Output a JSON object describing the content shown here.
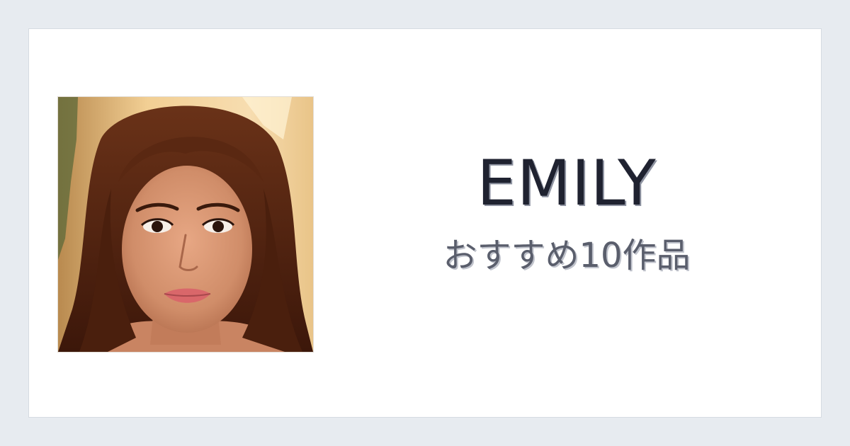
{
  "card": {
    "title": "EMILY",
    "subtitle": "おすすめ10作品"
  },
  "colors": {
    "page_background": "#e7ebf0",
    "card_background": "#ffffff",
    "title_text": "#1f2230",
    "subtitle_text": "#5a5e6c"
  }
}
